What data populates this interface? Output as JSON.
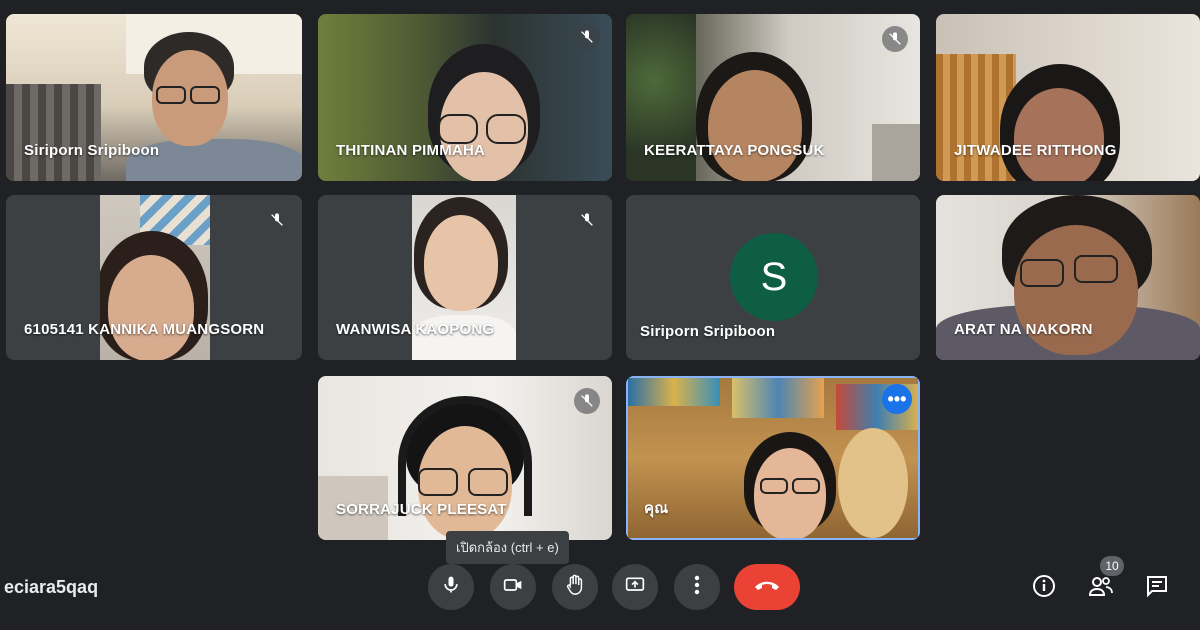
{
  "participants": [
    {
      "name": "Siriporn Sripiboon"
    },
    {
      "name": "THITINAN PIMMAHA"
    },
    {
      "name": "KEERATTAYA PONGSUK"
    },
    {
      "name": "JITWADEE RITTHONG"
    },
    {
      "name": "6105141 KANNIKA MUANGSORN"
    },
    {
      "name": "WANWISA KAOPONG"
    },
    {
      "name": "Siriporn Sripiboon",
      "avatar_letter": "S",
      "avatar_color": "#0e5e44"
    },
    {
      "name": "ARAT NA NAKORN"
    },
    {
      "name": "SORRAJUCK PLEESAT"
    },
    {
      "name": "คุณ"
    }
  ],
  "tooltip": "เปิดกล้อง (ctrl + e)",
  "meeting_code": "eciara5qaq",
  "participant_count": "10",
  "icons": {
    "mic": "microphone-icon",
    "camera": "camera-icon",
    "hand": "raise-hand-icon",
    "present": "present-screen-icon",
    "more": "more-options-icon",
    "end": "end-call-icon",
    "info": "info-icon",
    "people": "people-icon",
    "chat": "chat-icon"
  },
  "colors": {
    "background": "#202124",
    "tile": "#3c4043",
    "end_call": "#ea4335",
    "accent": "#1a73e8"
  }
}
